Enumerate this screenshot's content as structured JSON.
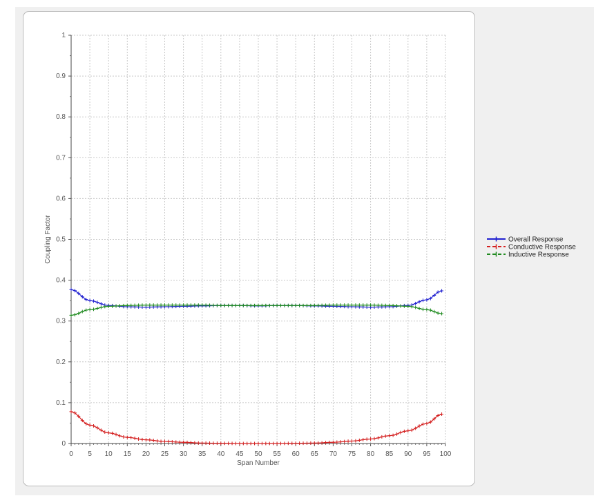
{
  "chart_data": {
    "type": "line",
    "title": "",
    "xlabel": "Span Number",
    "ylabel": "Coupling Factor",
    "xlim": [
      0,
      100
    ],
    "ylim": [
      0,
      1
    ],
    "x_ticks": [
      "0",
      "5",
      "10",
      "15",
      "20",
      "25",
      "30",
      "35",
      "40",
      "45",
      "50",
      "55",
      "60",
      "65",
      "70",
      "75",
      "80",
      "85",
      "90",
      "95",
      "100"
    ],
    "y_ticks": [
      "0",
      "0.1",
      "0.2",
      "0.3",
      "0.4",
      "0.5",
      "0.6",
      "0.7",
      "0.8",
      "0.9",
      "1"
    ],
    "grid": true,
    "legend_position": "right",
    "x": [
      0,
      5,
      10,
      15,
      20,
      25,
      30,
      35,
      40,
      45,
      50,
      55,
      60,
      65,
      70,
      75,
      80,
      85,
      90,
      95,
      99
    ],
    "series": [
      {
        "name": "Overall Response",
        "color": "#1f1fd0",
        "dashed": false,
        "values": [
          0.377,
          0.35,
          0.338,
          0.335,
          0.334,
          0.335,
          0.336,
          0.337,
          0.338,
          0.338,
          0.337,
          0.338,
          0.338,
          0.337,
          0.336,
          0.335,
          0.334,
          0.335,
          0.338,
          0.352,
          0.374
        ]
      },
      {
        "name": "Conductive Response",
        "color": "#d42020",
        "dashed": true,
        "values": [
          0.078,
          0.045,
          0.026,
          0.015,
          0.009,
          0.005,
          0.003,
          0.001,
          0.0005,
          0.0,
          0.0,
          0.0,
          0.0005,
          0.001,
          0.003,
          0.006,
          0.011,
          0.019,
          0.031,
          0.049,
          0.072
        ]
      },
      {
        "name": "Inductive Response",
        "color": "#1f8a1f",
        "dashed": true,
        "values": [
          0.314,
          0.328,
          0.336,
          0.338,
          0.339,
          0.339,
          0.339,
          0.339,
          0.338,
          0.338,
          0.338,
          0.338,
          0.338,
          0.338,
          0.339,
          0.339,
          0.339,
          0.338,
          0.336,
          0.328,
          0.318
        ]
      }
    ]
  }
}
